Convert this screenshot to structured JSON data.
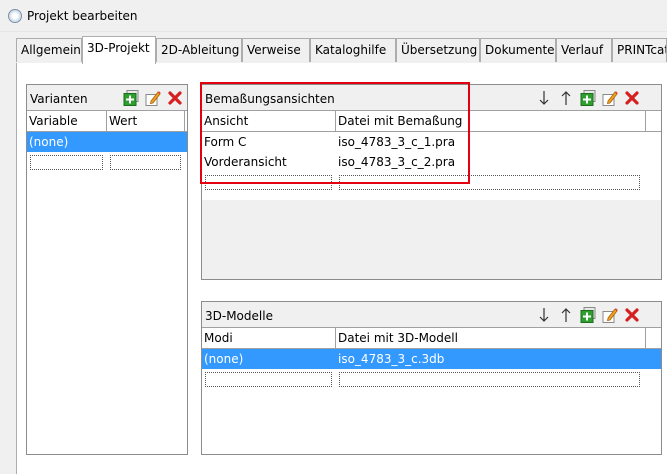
{
  "window": {
    "title": "Projekt bearbeiten",
    "icon": "app-circle-icon"
  },
  "tabs": [
    {
      "label": "Allgemein",
      "active": false
    },
    {
      "label": "3D-Projekt",
      "active": true
    },
    {
      "label": "2D-Ableitung",
      "active": false
    },
    {
      "label": "Verweise",
      "active": false
    },
    {
      "label": "Kataloghilfe",
      "active": false
    },
    {
      "label": "Übersetzung",
      "active": false
    },
    {
      "label": "Dokumente",
      "active": false
    },
    {
      "label": "Verlauf",
      "active": false
    },
    {
      "label": "PRINTcatalog",
      "active": false
    }
  ],
  "varianten": {
    "title": "Varianten",
    "toolbar": [
      "add-green-icon",
      "edit-pencil-icon",
      "delete-red-x-icon"
    ],
    "columns": [
      "Variable",
      "Wert"
    ],
    "rows": [
      {
        "c1": "(none)",
        "c2": "",
        "selected": true
      }
    ]
  },
  "bemassung": {
    "title": "Bemaßungsansichten",
    "toolbar": [
      "move-down-arrow-icon",
      "move-up-arrow-icon",
      "add-green-icon",
      "edit-pencil-icon",
      "delete-red-x-icon"
    ],
    "columns": [
      "Ansicht",
      "Datei mit Bemaßung"
    ],
    "rows": [
      {
        "c1": "Form C",
        "c2": "iso_4783_3_c_1.pra",
        "selected": false
      },
      {
        "c1": "Vorderansicht",
        "c2": "iso_4783_3_c_2.pra",
        "selected": false
      }
    ],
    "highlight_color": "#e3000f"
  },
  "modelle": {
    "title": "3D-Modelle",
    "toolbar": [
      "move-down-arrow-icon",
      "move-up-arrow-icon",
      "add-green-icon",
      "edit-pencil-icon",
      "delete-red-x-icon"
    ],
    "columns": [
      "Modi",
      "Datei mit 3D-Modell"
    ],
    "rows": [
      {
        "c1": "(none)",
        "c2": "iso_4783_3_c.3db",
        "selected": true
      }
    ]
  },
  "colors": {
    "selection": "#3399ff",
    "add": "#2e9e2e",
    "delete": "#d61f1f"
  }
}
